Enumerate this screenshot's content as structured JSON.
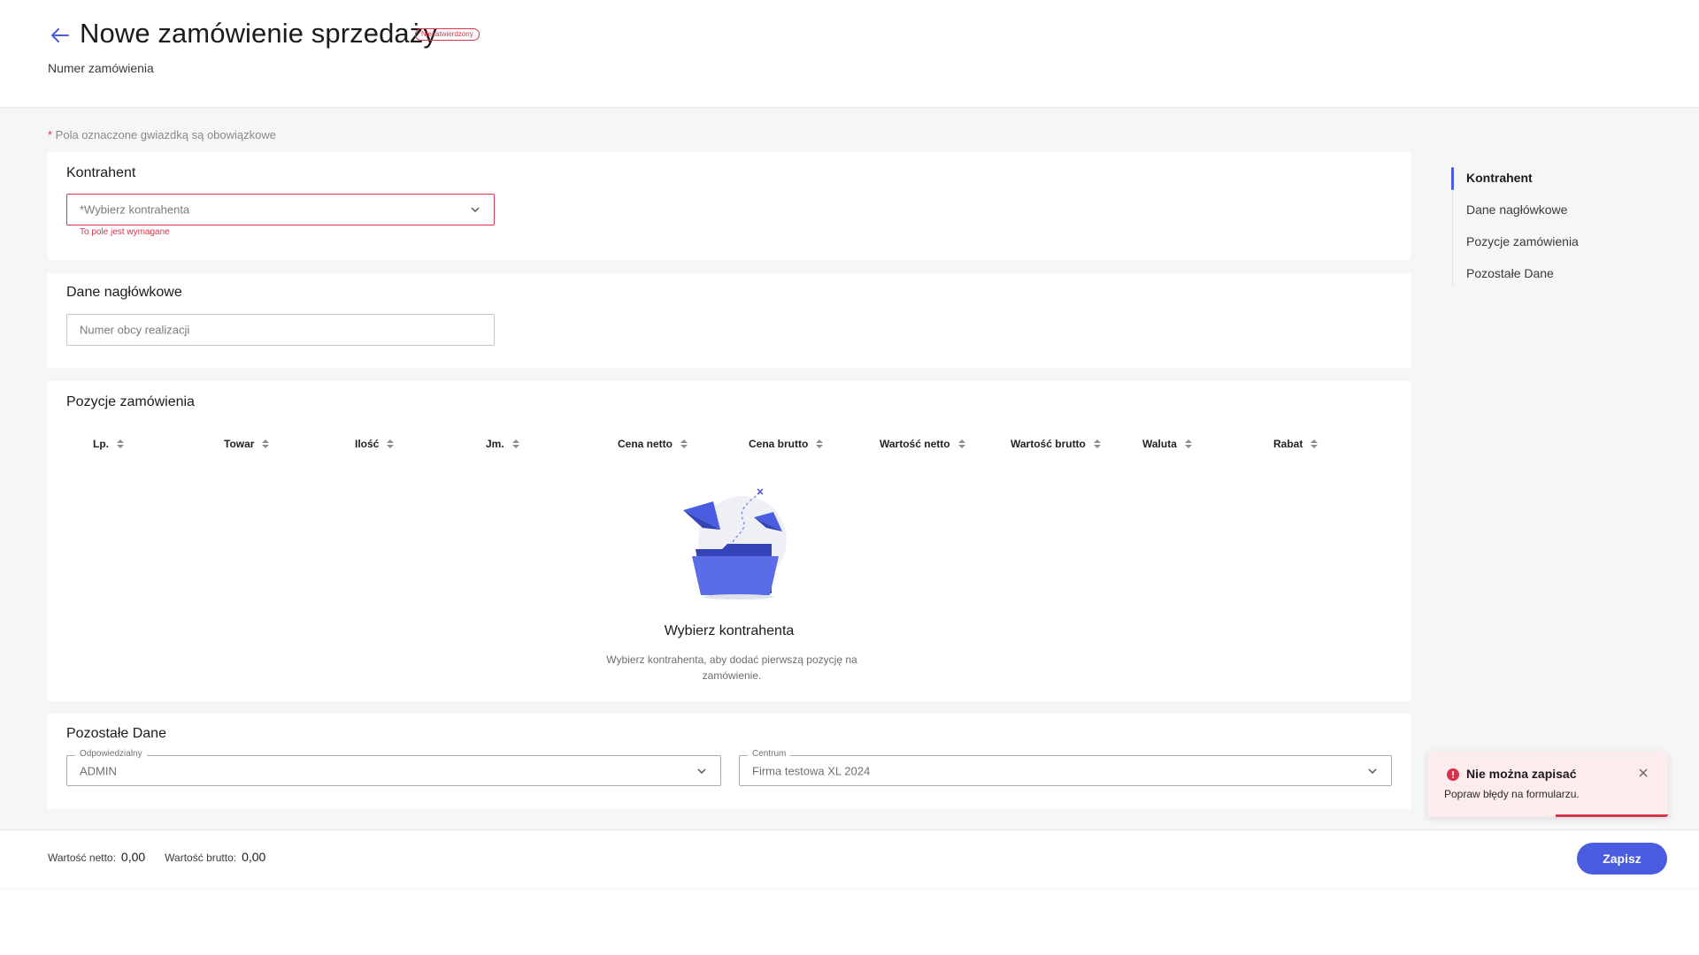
{
  "header": {
    "title": "Nowe zamówienie sprzedaży",
    "status_badge": "Niezatwierdzony",
    "order_number_label": "Numer zamówienia"
  },
  "form": {
    "required_note_star": "*",
    "required_note": " Pola oznaczone gwiazdką są obowiązkowe",
    "contractor": {
      "title": "Kontrahent",
      "placeholder": "*Wybierz kontrahenta",
      "error": "To pole jest wymagane"
    },
    "header_data": {
      "title": "Dane nagłówkowe",
      "foreign_number_placeholder": "Numer obcy realizacji"
    },
    "positions": {
      "title": "Pozycje zamówienia",
      "columns": [
        "Lp.",
        "Towar",
        "Ilość",
        "Jm.",
        "Cena netto",
        "Cena brutto",
        "Wartość netto",
        "Wartość brutto",
        "Waluta",
        "Rabat"
      ],
      "empty_title": "Wybierz kontrahenta",
      "empty_description": "Wybierz kontrahenta, aby dodać pierwszą pozycję na zamówienie."
    },
    "other": {
      "title": "Pozostałe Dane",
      "responsible_label": "Odpowiedzialny",
      "responsible_value": "ADMIN",
      "center_label": "Centrum",
      "center_value": "Firma testowa XL 2024"
    }
  },
  "toc": {
    "items": [
      "Kontrahent",
      "Dane nagłówkowe",
      "Pozycje zamówienia",
      "Pozostałe Dane"
    ],
    "active_index": 0
  },
  "footer": {
    "net_label": "Wartość netto:",
    "net_value": "0,00",
    "gross_label": "Wartość brutto:",
    "gross_value": "0,00",
    "save_label": "Zapisz"
  },
  "toast": {
    "title": "Nie można zapisać",
    "message": "Popraw błędy na formularzu."
  },
  "colors": {
    "accent": "#4a5ce0",
    "error": "#d6344b",
    "toast_bg": "#fdecee"
  }
}
